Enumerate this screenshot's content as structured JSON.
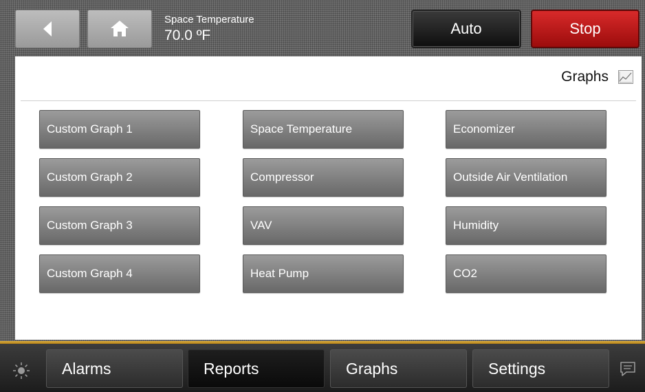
{
  "header": {
    "space_label": "Space Temperature",
    "space_value": "70.0 ºF",
    "auto_label": "Auto",
    "stop_label": "Stop",
    "stop_color": "#c01a1a"
  },
  "panel": {
    "title": "Graphs",
    "graph_buttons": [
      [
        "Custom Graph 1",
        "Space Temperature",
        "Economizer"
      ],
      [
        "Custom Graph 2",
        "Compressor",
        "Outside Air Ventilation"
      ],
      [
        "Custom Graph 3",
        "VAV",
        "Humidity"
      ],
      [
        "Custom Graph 4",
        "Heat Pump",
        "CO2"
      ]
    ]
  },
  "footer": {
    "tabs": [
      "Alarms",
      "Reports",
      "Graphs",
      "Settings"
    ],
    "active_tab": "Reports",
    "accent_color": "#d9a62e"
  },
  "icons": [
    "back-arrow-icon",
    "home-icon",
    "graph-icon",
    "sun-icon",
    "chat-icon"
  ]
}
